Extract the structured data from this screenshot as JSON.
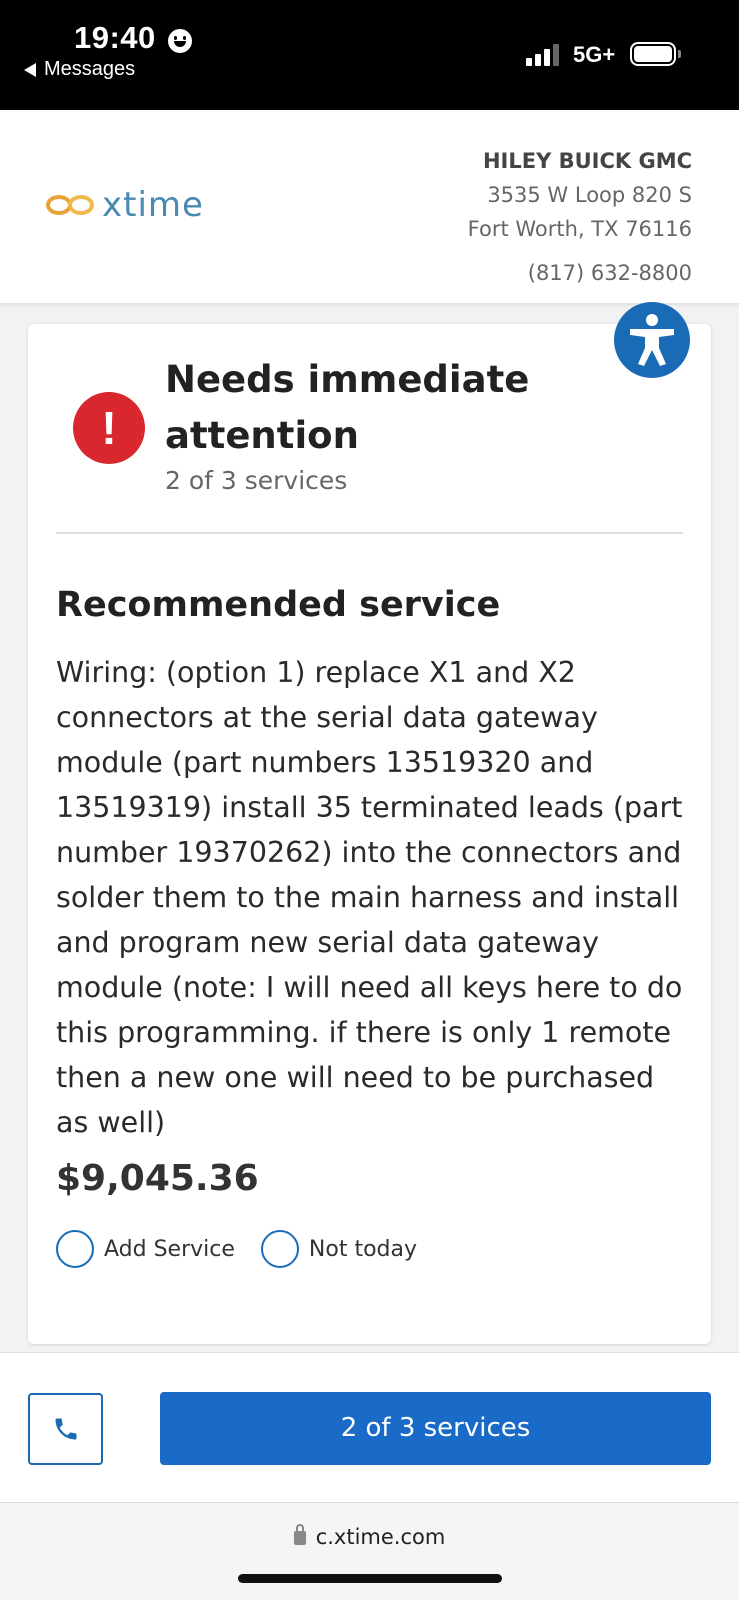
{
  "status_bar": {
    "time": "19:40",
    "back_label": "Messages",
    "network": "5G+"
  },
  "header": {
    "logo_text": "xtime",
    "dealer_name": "HILEY BUICK GMC",
    "address_line1": "3535 W Loop 820 S",
    "address_line2": "Fort Worth, TX 76116",
    "phone": "(817) 632-8800"
  },
  "card": {
    "alert_glyph": "!",
    "title": "Needs immediate attention",
    "subtitle": "2 of 3 services",
    "section_title": "Recommended service",
    "description": "Wiring: (option 1) replace X1 and X2 connectors at the serial data gateway module (part numbers 13519320 and 13519319) install 35 terminated leads (part number 19370262) into the connectors and solder them to the main harness and install and program new serial data gateway module (note: I will need all keys here to do this programming. if there is only 1 remote then a new one will need to be purchased as well)",
    "price": "$9,045.36",
    "options": [
      {
        "label": "Add Service"
      },
      {
        "label": "Not today"
      }
    ]
  },
  "bottom": {
    "services_button": "2 of 3 services"
  },
  "browser": {
    "url": "c.xtime.com"
  },
  "colors": {
    "primary": "#1a6bc8",
    "alert": "#d9272e",
    "logo_orange": "#e8a23a",
    "logo_blue": "#4a8ab0"
  },
  "icons": [
    "smiley-icon",
    "back-arrow-icon",
    "signal-icon",
    "battery-icon",
    "accessibility-icon",
    "alert-icon",
    "phone-icon",
    "lock-icon"
  ]
}
